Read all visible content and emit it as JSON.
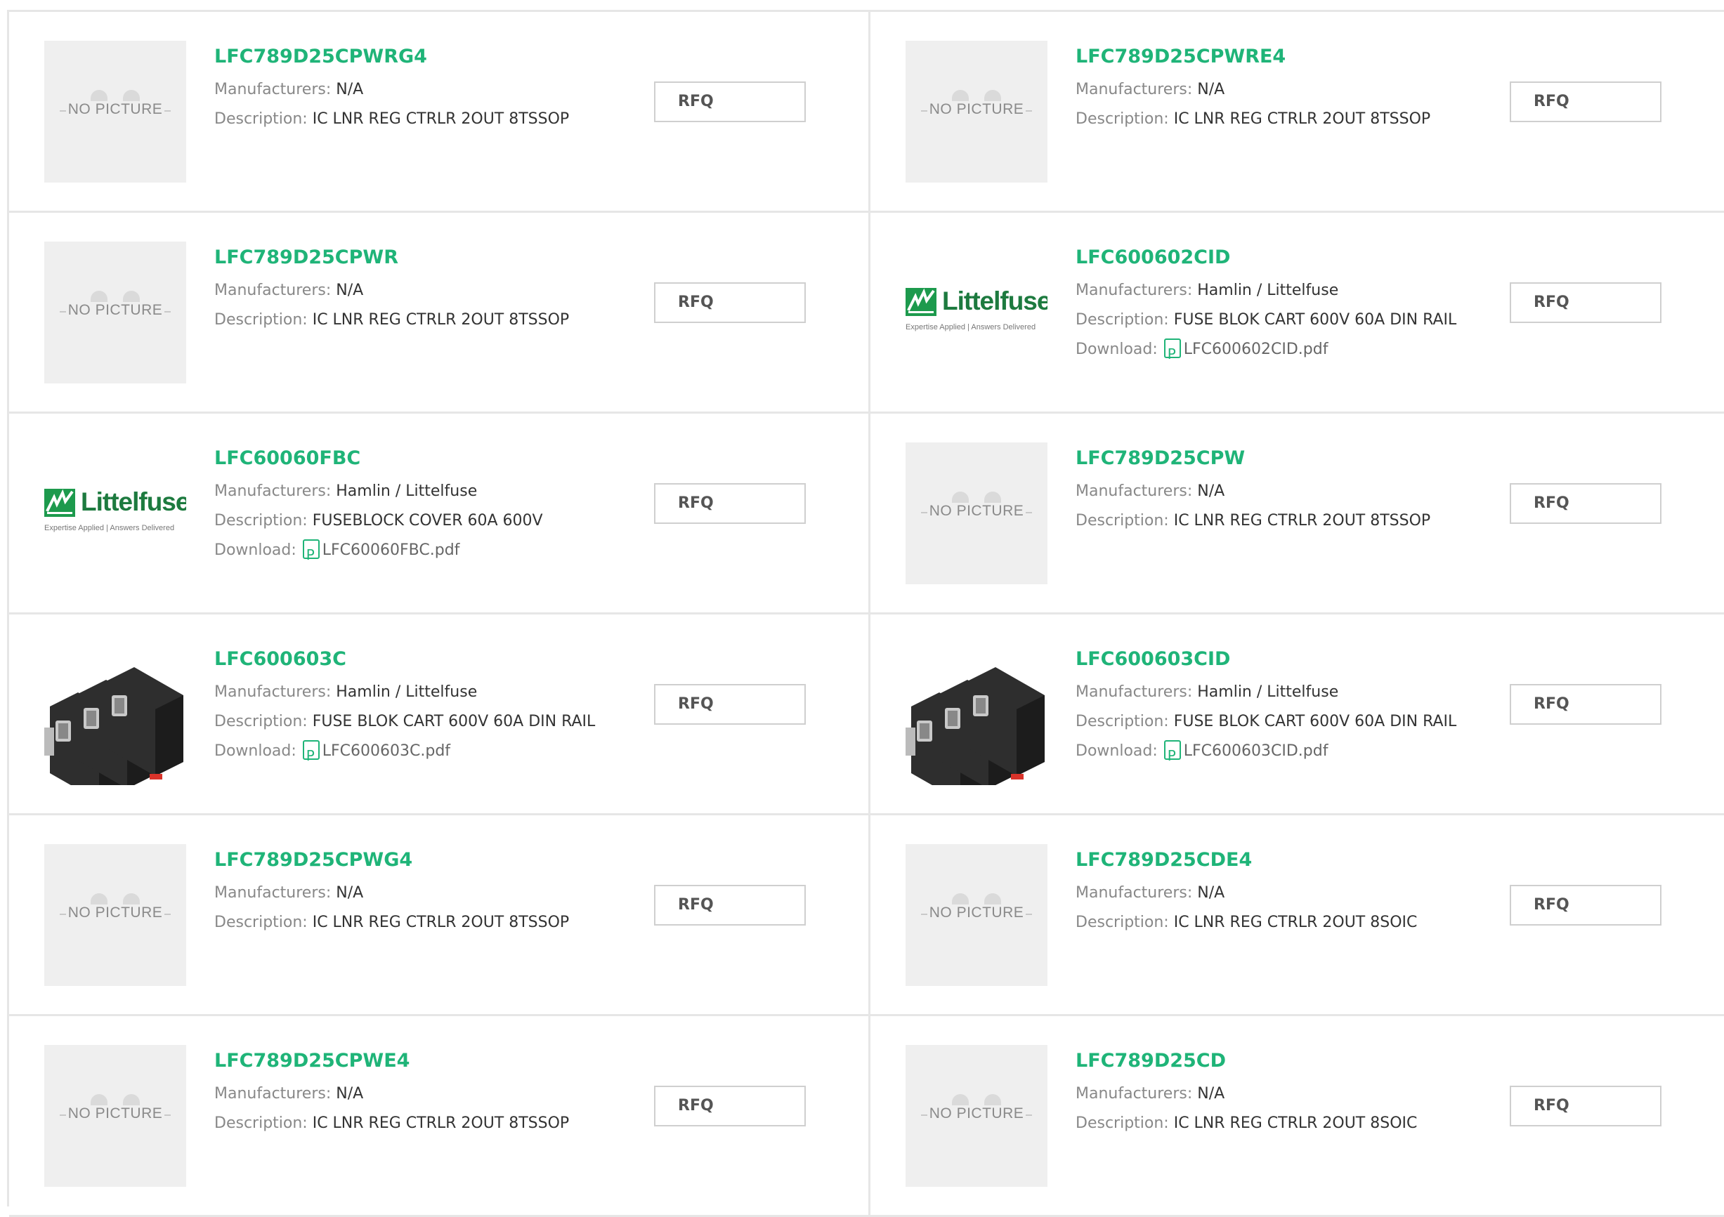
{
  "labels": {
    "manufacturers": "Manufacturers: ",
    "description": "Description: ",
    "download": "Download: ",
    "rfq": "RFQ",
    "no_picture": "NO PICTURE",
    "logo_word": "Littelfuse",
    "logo_tag": "Expertise Applied | Answers Delivered"
  },
  "products": [
    {
      "part": "LFC789D25CPWRG4",
      "manufacturer": "N/A",
      "description": "IC LNR REG CTRLR 2OUT 8TSSOP",
      "download": null,
      "image": "no-picture"
    },
    {
      "part": "LFC789D25CPWRE4",
      "manufacturer": "N/A",
      "description": "IC LNR REG CTRLR 2OUT 8TSSOP",
      "download": null,
      "image": "no-picture"
    },
    {
      "part": "LFC789D25CPWR",
      "manufacturer": "N/A",
      "description": "IC LNR REG CTRLR 2OUT 8TSSOP",
      "download": null,
      "image": "no-picture"
    },
    {
      "part": "LFC600602CID",
      "manufacturer": "Hamlin / Littelfuse",
      "description": "FUSE BLOK CART 600V 60A DIN RAIL",
      "download": "LFC600602CID.pdf",
      "image": "littelfuse-logo"
    },
    {
      "part": "LFC60060FBC",
      "manufacturer": "Hamlin / Littelfuse",
      "description": "FUSEBLOCK COVER 60A 600V",
      "download": "LFC60060FBC.pdf",
      "image": "littelfuse-logo"
    },
    {
      "part": "LFC789D25CPW",
      "manufacturer": "N/A",
      "description": "IC LNR REG CTRLR 2OUT 8TSSOP",
      "download": null,
      "image": "no-picture"
    },
    {
      "part": "LFC600603C",
      "manufacturer": "Hamlin / Littelfuse",
      "description": "FUSE BLOK CART 600V 60A DIN RAIL",
      "download": "LFC600603C.pdf",
      "image": "fuse-block-photo"
    },
    {
      "part": "LFC600603CID",
      "manufacturer": "Hamlin / Littelfuse",
      "description": "FUSE BLOK CART 600V 60A DIN RAIL",
      "download": "LFC600603CID.pdf",
      "image": "fuse-block-photo"
    },
    {
      "part": "LFC789D25CPWG4",
      "manufacturer": "N/A",
      "description": "IC LNR REG CTRLR 2OUT 8TSSOP",
      "download": null,
      "image": "no-picture"
    },
    {
      "part": "LFC789D25CDE4",
      "manufacturer": "N/A",
      "description": "IC LNR REG CTRLR 2OUT 8SOIC",
      "download": null,
      "image": "no-picture"
    },
    {
      "part": "LFC789D25CPWE4",
      "manufacturer": "N/A",
      "description": "IC LNR REG CTRLR 2OUT 8TSSOP",
      "download": null,
      "image": "no-picture"
    },
    {
      "part": "LFC789D25CD",
      "manufacturer": "N/A",
      "description": "IC LNR REG CTRLR 2OUT 8SOIC",
      "download": null,
      "image": "no-picture"
    }
  ],
  "colors": {
    "part_link": "#1fb478",
    "label_gray": "#888888",
    "border": "#e6e6e6",
    "logo_green": "#1d9a4d"
  }
}
